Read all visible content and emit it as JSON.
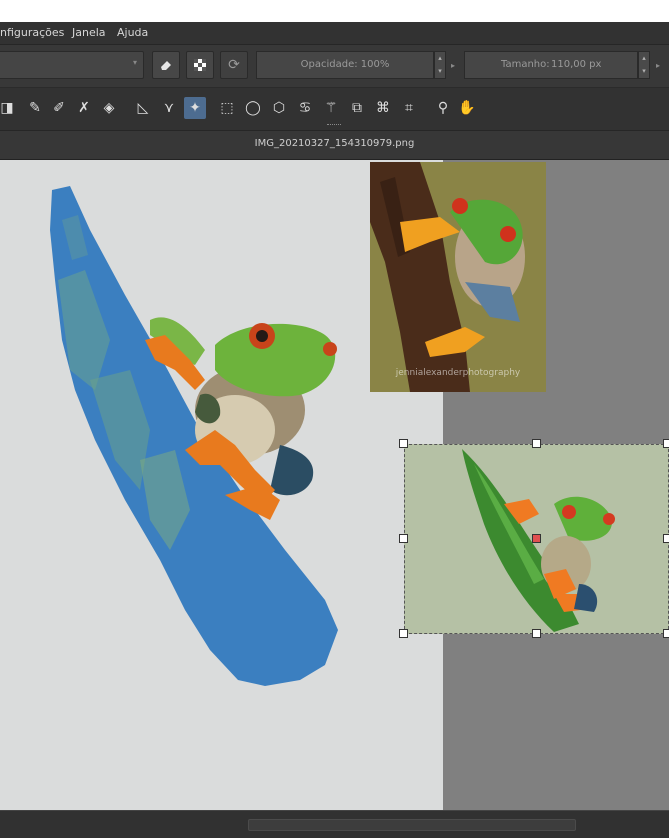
{
  "menubar": {
    "items": [
      "nfigurações",
      "Janela",
      "Ajuda"
    ]
  },
  "tool_options": {
    "opacity_label": "Opacidade: 100%",
    "size_label": "Tamanho:",
    "size_value": "110,00 px"
  },
  "document": {
    "title": "IMG_20210327_154310979.png"
  },
  "reference_photo": {
    "watermark": "jennialexanderphotography"
  },
  "colors": {
    "accent_active_tool": "#4d6c90",
    "canvas_bg": "#dadcdc",
    "workspace_bg": "#808080"
  },
  "icons": [
    "eraser-icon",
    "alpha-lock-icon",
    "refresh-icon",
    "picker-icon",
    "smart-patch-icon",
    "assistant-icon",
    "fill-icon",
    "measure-icon",
    "perspective-icon",
    "reference-tool-icon",
    "rect-select-icon",
    "ellipse-select-icon",
    "polygon-select-icon",
    "freehand-select-icon",
    "magic-wand-icon",
    "similar-select-icon",
    "bezier-select-icon",
    "magnetic-select-icon",
    "zoom-icon",
    "pan-icon"
  ]
}
